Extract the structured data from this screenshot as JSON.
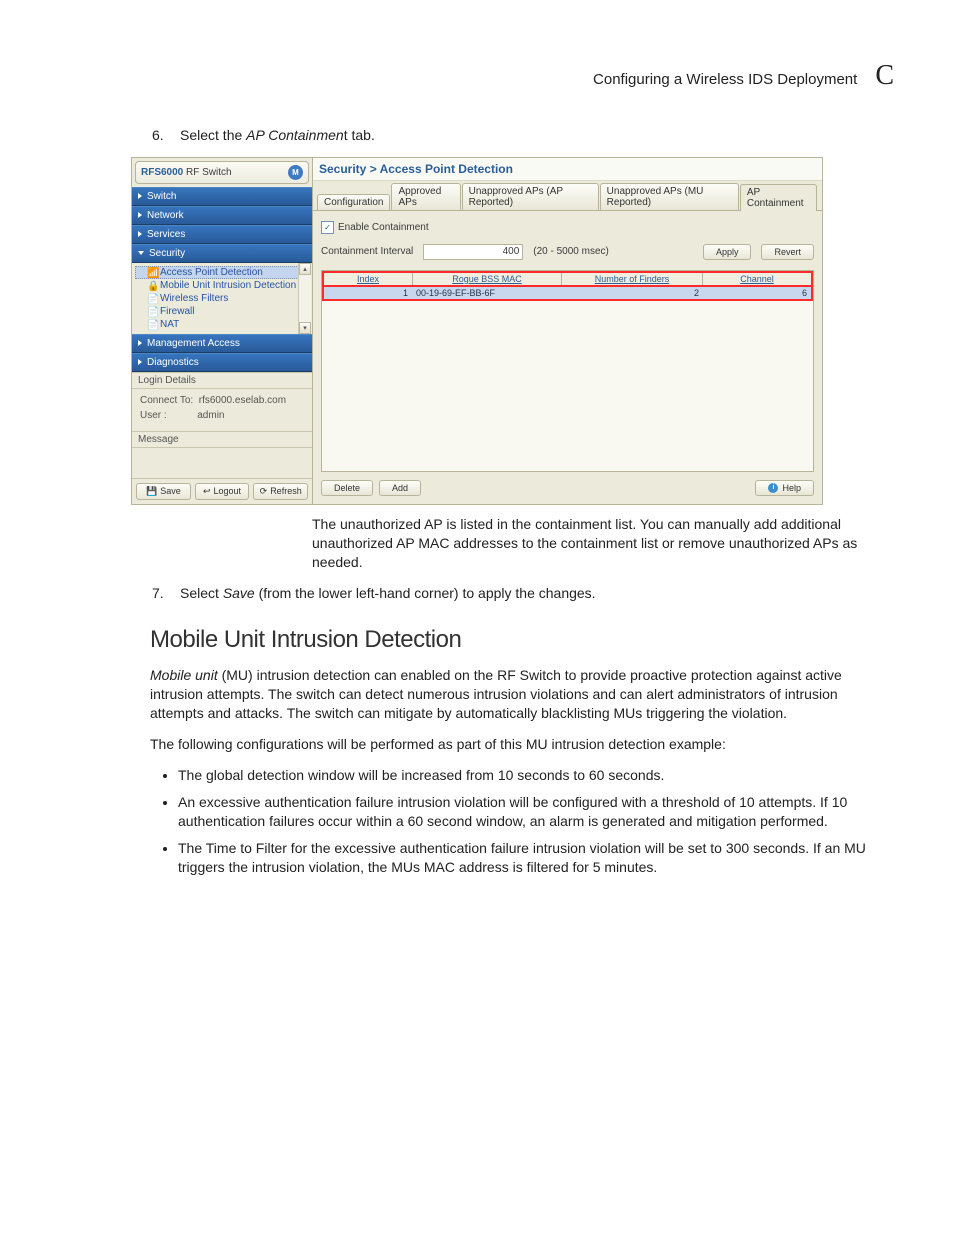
{
  "page_header": {
    "title": "Configuring a Wireless IDS Deployment",
    "appendix": "C"
  },
  "step6": {
    "num": "6.",
    "pre": "Select the ",
    "em": "AP Containmen",
    "post": "t tab."
  },
  "shot": {
    "device_model": "RFS6000",
    "device_type": "RF Switch",
    "nav": {
      "switch": "Switch",
      "network": "Network",
      "services": "Services",
      "security": "Security",
      "mgmt": "Management Access",
      "diag": "Diagnostics"
    },
    "tree": {
      "apd": "Access Point Detection",
      "muid": "Mobile Unit Intrusion Detection",
      "wf": "Wireless Filters",
      "fw": "Firewall",
      "nat": "NAT"
    },
    "login": {
      "head": "Login Details",
      "connect_label": "Connect To:",
      "connect_value": "rfs6000.eselab.com",
      "user_label": "User :",
      "user_value": "admin",
      "msg": "Message"
    },
    "sidebar_btns": {
      "save": "Save",
      "logout": "Logout",
      "refresh": "Refresh"
    },
    "crumb": "Security > Access Point Detection",
    "tabs": {
      "config": "Configuration",
      "approved": "Approved APs",
      "un_ap": "Unapproved APs (AP Reported)",
      "un_mu": "Unapproved APs (MU Reported)",
      "contain": "AP Containment"
    },
    "enable_label": "Enable Containment",
    "interval_label": "Containment Interval",
    "interval_value": "400",
    "interval_hint": "(20 - 5000 msec)",
    "apply": "Apply",
    "revert": "Revert",
    "table": {
      "h_index": "Index",
      "h_mac": "Rogue BSS MAC",
      "h_finders": "Number of Finders",
      "h_channel": "Channel",
      "r_index": "1",
      "r_mac": "00-19-69-EF-BB-6F",
      "r_finders": "2",
      "r_channel": "6"
    },
    "footer": {
      "delete": "Delete",
      "add": "Add",
      "help": "Help"
    }
  },
  "after_shot": "The unauthorized AP is listed in the containment list. You can manually add additional unauthorized AP MAC addresses to the containment list or remove unauthorized APs as needed.",
  "step7": {
    "num": "7.",
    "pre": "Select ",
    "em": "Save",
    "post": " (from the lower left-hand corner) to apply the changes."
  },
  "h2": "Mobile Unit Intrusion Detection",
  "p1": {
    "em": "Mobile unit",
    "rest": " (MU) intrusion detection can enabled on the RF Switch to provide proactive protection against active intrusion attempts. The switch can detect numerous intrusion violations and can alert administrators of intrusion attempts and attacks. The switch can mitigate by automatically blacklisting MUs triggering the violation."
  },
  "p2": "The following configurations will be performed as part of this MU intrusion detection example:",
  "bullets": {
    "b1": "The global detection window will be increased from 10 seconds to 60 seconds.",
    "b2": "An excessive authentication failure intrusion violation will be configured with a threshold of 10 attempts. If 10 authentication failures occur within a 60 second window, an alarm is generated and mitigation performed.",
    "b3": "The Time to Filter for the excessive authentication failure intrusion violation will be set to 300 seconds. If an MU triggers the intrusion violation, the MUs MAC address is filtered for 5 minutes."
  }
}
